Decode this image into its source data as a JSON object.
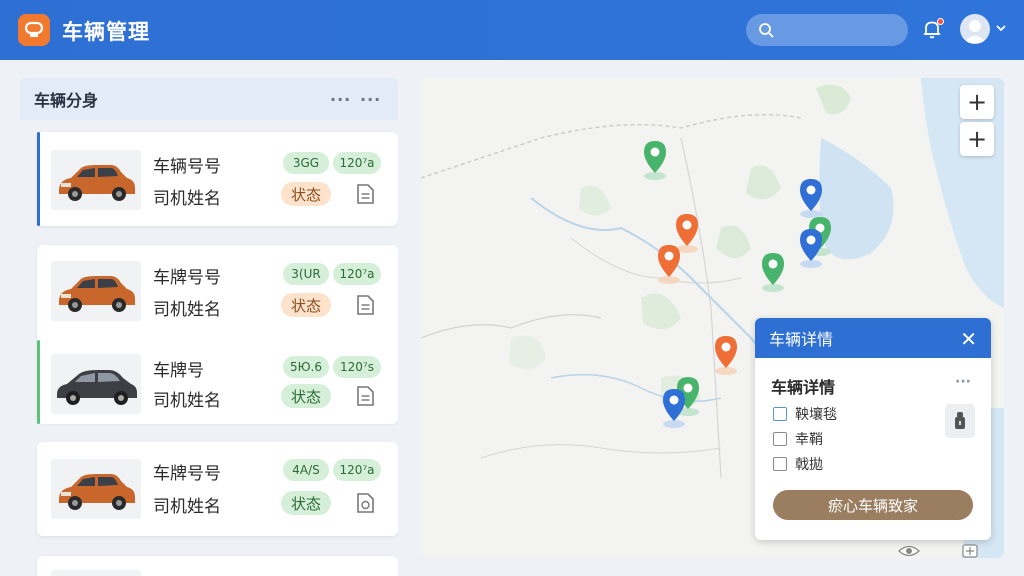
{
  "app": {
    "title": "车辆管理"
  },
  "search": {
    "placeholder": ""
  },
  "colors": {
    "brand": "#2e6fd3",
    "accent_orange": "#f27a2e",
    "tag_green": "#d5efd9",
    "status_orange": "#fde3cc"
  },
  "panel": {
    "title": "车辆分身",
    "cards": [
      {
        "plate_label": "车辆号号",
        "driver_label": "司机姓名",
        "tag1": "3GG",
        "tag2": "120⁷a",
        "status": "状态",
        "status_color": "orange",
        "accent": "#2e6fd3",
        "car_color": "orange"
      },
      {
        "plate_label": "车牌号号",
        "driver_label": "司机姓名",
        "tag1": "3(UR",
        "tag2": "120⁷a",
        "status": "状态",
        "status_color": "orange",
        "accent": "",
        "car_color": "orange"
      },
      {
        "plate_label": "车牌号",
        "driver_label": "司机姓名",
        "tag1": "5Ю.6",
        "tag2": "120⁷s",
        "status": "状态",
        "status_color": "green",
        "accent": "#5cc37a",
        "car_color": "dark"
      },
      {
        "plate_label": "车牌号号",
        "driver_label": "司机姓名",
        "tag1": "4A/S",
        "tag2": "120⁷a",
        "status": "状态",
        "status_color": "green",
        "accent": "",
        "car_color": "orange"
      }
    ]
  },
  "map": {
    "zoom_in": "+",
    "zoom_out": "+",
    "pins": [
      {
        "color": "green"
      },
      {
        "color": "orange"
      },
      {
        "color": "orange"
      },
      {
        "color": "blue"
      },
      {
        "color": "green"
      },
      {
        "color": "blue"
      },
      {
        "color": "green"
      },
      {
        "color": "orange"
      },
      {
        "color": "green"
      },
      {
        "color": "blue"
      }
    ]
  },
  "popup": {
    "title": "车辆详情",
    "close": "✕",
    "subtitle": "车辆详情",
    "more": "···",
    "options": [
      "鞅壤毯",
      "幸鞘",
      "戟拋"
    ],
    "action": "瘀心车辆致家"
  }
}
